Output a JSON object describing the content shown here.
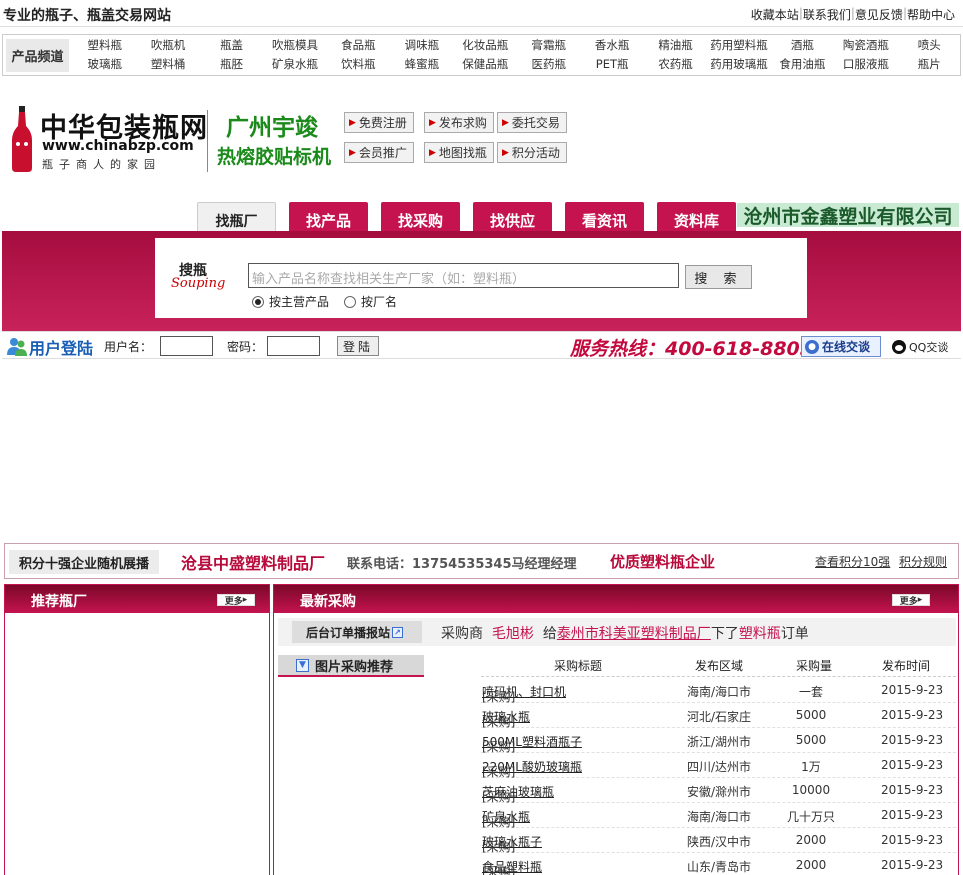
{
  "top": {
    "slogan": "专业的瓶子、瓶盖交易网站",
    "links": [
      "收藏本站",
      "联系我们",
      "意见反馈",
      "帮助中心"
    ]
  },
  "product_channel": {
    "label": "产品频道",
    "row1": [
      "塑料瓶",
      "吹瓶机",
      "瓶盖",
      "吹瓶模具",
      "食品瓶",
      "调味瓶",
      "化妆品瓶",
      "膏霜瓶",
      "香水瓶",
      "精油瓶",
      "药用塑料瓶",
      "酒瓶",
      "陶瓷酒瓶",
      "喷头"
    ],
    "row2": [
      "玻璃瓶",
      "塑料桶",
      "瓶胚",
      "矿泉水瓶",
      "饮料瓶",
      "蜂蜜瓶",
      "保健品瓶",
      "医药瓶",
      "PET瓶",
      "农药瓶",
      "药用玻璃瓶",
      "食用油瓶",
      "口服液瓶",
      "瓶片"
    ]
  },
  "logo": {
    "name": "中华包装瓶网",
    "domain": "www.chinabzp.com",
    "tagline": "瓶子商人的家园"
  },
  "brand_ad": {
    "line1": "广州宇竣",
    "line2": "热熔胶贴标机"
  },
  "quick_buttons": [
    "免费注册",
    "发布求购",
    "委托交易",
    "会员推广",
    "地图找瓶",
    "积分活动"
  ],
  "tabs": [
    "找瓶厂",
    "找产品",
    "找采购",
    "找供应",
    "看资讯",
    "资料库"
  ],
  "ad_company": "沧州市金鑫塑业有限公司",
  "search": {
    "logo_cn": "搜瓶",
    "logo_en": "Souping",
    "placeholder": "输入产品名称查找相关生产厂家（如：塑料瓶）",
    "button": "搜 索",
    "options": [
      "按主营产品",
      "按厂名"
    ]
  },
  "login": {
    "title": "用户登陆",
    "username_label": "用户名：",
    "password_label": "密码：",
    "button": "登陆",
    "hotline": "服务热线：400-618-8805",
    "online_chat": "在线交谈",
    "qq_chat": "QQ交谈"
  },
  "rank": {
    "label": "积分十强企业随机展播",
    "company": "沧县中盛塑料制品厂",
    "phone": "联系电话：13754535345马经理经理",
    "quality": "优质塑料瓶企业",
    "links": [
      "查看积分10强",
      "积分规则"
    ]
  },
  "left_panel": {
    "title": "推荐瓶厂",
    "more": "更多"
  },
  "right_panel": {
    "title": "最新采购",
    "more": "更多",
    "ticker": {
      "label": "后台订单播报站",
      "prefix": "采购商",
      "buyer": "毛旭彬",
      "give": "给",
      "seller": "泰州市科美亚塑料制品厂",
      "mid": "下了",
      "product": "塑料瓶",
      "suffix": "订单"
    },
    "image_rec": "图片采购推荐",
    "columns": [
      "采购标题",
      "发布区域",
      "采购量",
      "发布时间"
    ],
    "rows": [
      {
        "tag": "[采购]",
        "title": "喷码机、封口机",
        "region": "海南/海口市",
        "qty": "一套",
        "date": "2015-9-23"
      },
      {
        "tag": "[采购]",
        "title": "玻璃水瓶",
        "region": "河北/石家庄",
        "qty": "5000",
        "date": "2015-9-23"
      },
      {
        "tag": "[采购]",
        "title": "500ML塑料酒瓶子",
        "region": "浙江/湖州市",
        "qty": "5000",
        "date": "2015-9-23"
      },
      {
        "tag": "[采购]",
        "title": "220ML酸奶玻璃瓶",
        "region": "四川/达州市",
        "qty": "1万",
        "date": "2015-9-23"
      },
      {
        "tag": "[采购]",
        "title": "芝麻油玻璃瓶",
        "region": "安徽/滁州市",
        "qty": "10000",
        "date": "2015-9-23"
      },
      {
        "tag": "[采购]",
        "title": "矿泉水瓶",
        "region": "海南/海口市",
        "qty": "几十万只",
        "date": "2015-9-23"
      },
      {
        "tag": "[采购]",
        "title": "玻璃水瓶子",
        "region": "陕西/汉中市",
        "qty": "2000",
        "date": "2015-9-23"
      },
      {
        "tag": "[采购]",
        "title": "食品塑料瓶",
        "region": "山东/青岛市",
        "qty": "2000",
        "date": "2015-9-23"
      }
    ]
  },
  "colors": {
    "brand_red": "#c5134f",
    "green": "#1a8a1a",
    "blue": "#1a5fb4"
  }
}
